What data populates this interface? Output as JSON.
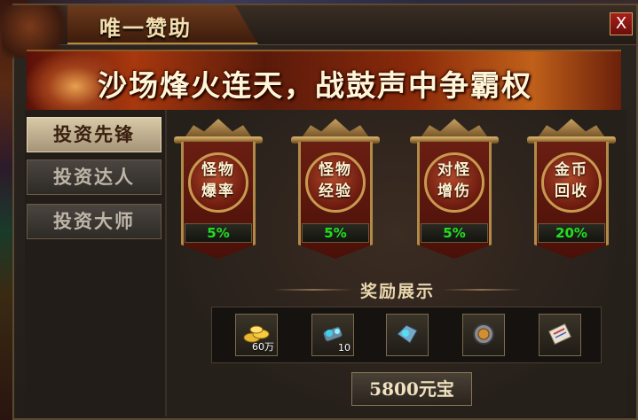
{
  "window": {
    "title": "唯一赞助",
    "close_label": "X"
  },
  "banner": {
    "slogan": "沙场烽火连天，战鼓声中争霸权"
  },
  "tabs": [
    {
      "label": "投资先锋",
      "active": true
    },
    {
      "label": "投资达人",
      "active": false
    },
    {
      "label": "投资大师",
      "active": false
    }
  ],
  "bonuses": [
    {
      "line1": "怪物",
      "line2": "爆率",
      "percent": "5%"
    },
    {
      "line1": "怪物",
      "line2": "经验",
      "percent": "5%"
    },
    {
      "line1": "对怪",
      "line2": "增伤",
      "percent": "5%"
    },
    {
      "line1": "金币",
      "line2": "回收",
      "percent": "20%"
    }
  ],
  "rewards": {
    "title": "奖励展示",
    "items": [
      {
        "icon": "gold-ingot-icon",
        "count": "60万"
      },
      {
        "icon": "gem-stone-icon",
        "count": "10"
      },
      {
        "icon": "crystal-shard-icon",
        "count": ""
      },
      {
        "icon": "medal-icon",
        "count": ""
      },
      {
        "icon": "scroll-icon",
        "count": ""
      }
    ]
  },
  "price": {
    "label": "5800元宝"
  },
  "colors": {
    "accent_gold": "#c89a50",
    "percent_green": "#20e020",
    "close_red": "#a8201a"
  }
}
